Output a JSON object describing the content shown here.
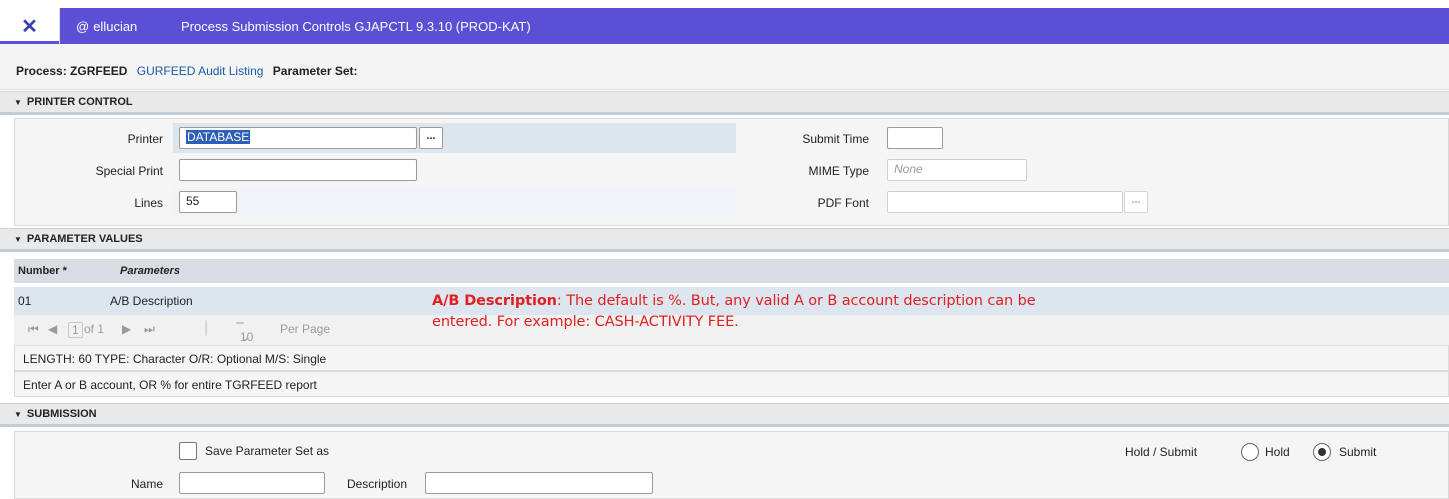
{
  "header": {
    "close_glyph": "✕",
    "logo_mark": "@",
    "logo_text": "ellucian",
    "title": "Process Submission Controls GJAPCTL 9.3.10 (PROD-KAT)"
  },
  "process": {
    "process_label": "Process:",
    "process_code": "ZGRFEED",
    "process_name": "GURFEED Audit Listing",
    "param_set_label": "Parameter Set:"
  },
  "printer_control": {
    "section_title": "PRINTER CONTROL",
    "printer_label": "Printer",
    "printer_value": "DATABASE",
    "special_print_label": "Special Print",
    "special_print_value": "",
    "lines_label": "Lines",
    "lines_value": "55",
    "submit_time_label": "Submit Time",
    "submit_time_value": "",
    "mime_type_label": "MIME Type",
    "mime_type_value": "None",
    "pdf_font_label": "PDF Font",
    "pdf_font_value": "",
    "lookup_glyph": "..."
  },
  "parameter_values": {
    "section_title": "PARAMETER VALUES",
    "columns": [
      "Number *",
      "Parameters"
    ],
    "rows": [
      {
        "number": "01",
        "parameter": "A/B Description"
      }
    ],
    "pager": {
      "first": "⏮",
      "prev": "◀",
      "page": "1",
      "of_text": "of 1",
      "next": "▶",
      "last": "⏭",
      "per_page_value": "10",
      "per_page_label": "Per Page"
    },
    "info_line": "LENGTH: 60 TYPE: Character O/R: Optional M/S: Single",
    "help_line": "Enter A or B account, OR % for entire TGRFEED report"
  },
  "annotation": {
    "bold_part": "A/B Description",
    "line1_rest": ":  The default is %.   But, any valid A or B account description can be",
    "line2": "entered.  For example:  CASH-ACTIVITY FEE.",
    "color": "#e02020"
  },
  "submission": {
    "section_title": "SUBMISSION",
    "save_param_label": "Save Parameter Set as",
    "save_param_checked": false,
    "name_label": "Name",
    "name_value": "",
    "description_label": "Description",
    "description_value": "",
    "hold_submit_label": "Hold / Submit",
    "hold_label": "Hold",
    "submit_label": "Submit",
    "selected": "Submit"
  },
  "colors": {
    "header_bg": "#5b4fd6",
    "link": "#1a5aa5",
    "selection": "#2e5fb8"
  }
}
